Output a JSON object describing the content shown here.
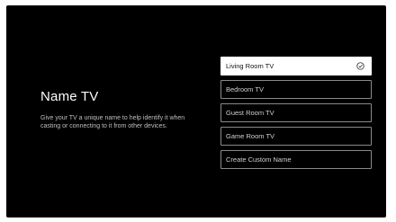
{
  "screen": {
    "title": "Name TV",
    "description": "Give your TV a unique name to help identify it when casting or connecting to it from other devices."
  },
  "options": [
    {
      "label": "Living Room TV",
      "selected": true
    },
    {
      "label": "Bedroom TV",
      "selected": false
    },
    {
      "label": "Guest Room TV",
      "selected": false
    },
    {
      "label": "Game Room TV",
      "selected": false
    },
    {
      "label": "Create Custom Name",
      "selected": false
    }
  ],
  "colors": {
    "background": "#000000",
    "selected_bg": "#ffffff",
    "border": "#8a8a8a"
  },
  "icons": {
    "selected_indicator": "check-circle-icon"
  }
}
